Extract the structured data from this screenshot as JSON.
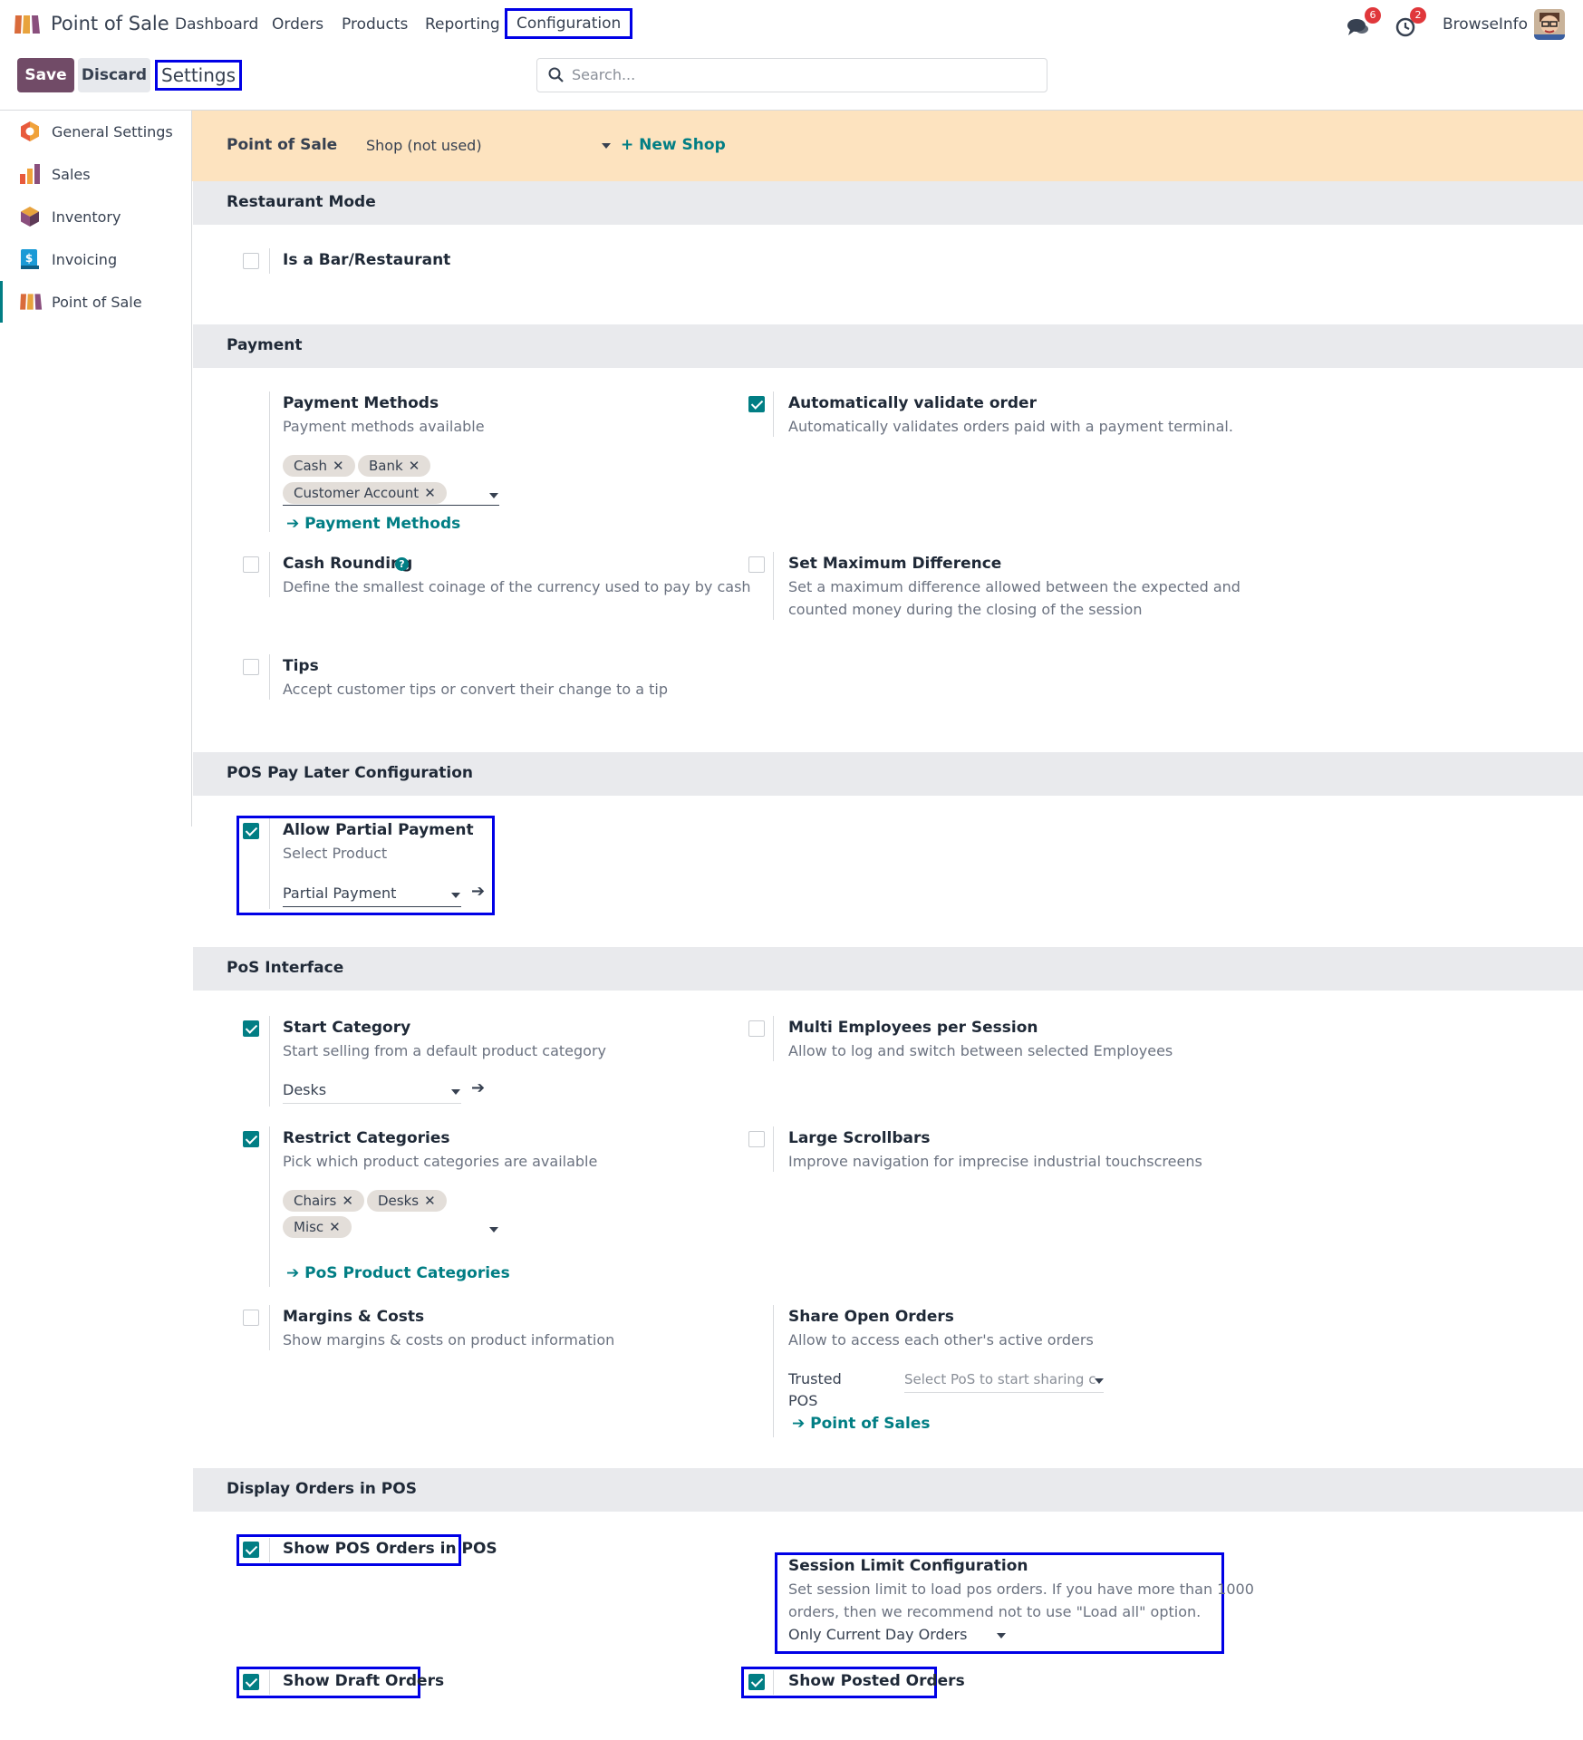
{
  "app": {
    "title": "Point of Sale"
  },
  "menu": {
    "items": [
      "Dashboard",
      "Orders",
      "Products",
      "Reporting",
      "Configuration"
    ]
  },
  "notifications": {
    "messages_count": "6",
    "activities_count": "2"
  },
  "user": {
    "name": "BrowseInfo"
  },
  "control": {
    "save_label": "Save",
    "discard_label": "Discard",
    "breadcrumb": "Settings",
    "search_placeholder": "Search..."
  },
  "sidebar": {
    "items": [
      {
        "label": "General Settings",
        "icon": "gear-hex-icon"
      },
      {
        "label": "Sales",
        "icon": "sales-chart-icon"
      },
      {
        "label": "Inventory",
        "icon": "inventory-box-icon"
      },
      {
        "label": "Invoicing",
        "icon": "invoice-dollar-icon"
      },
      {
        "label": "Point of Sale",
        "icon": "pos-shop-icon"
      }
    ]
  },
  "banner": {
    "label": "Point of Sale",
    "value": "Shop (not used)",
    "new_label": "+ New Shop"
  },
  "sections": {
    "restaurant": {
      "title": "Restaurant Mode",
      "is_bar": {
        "label": "Is a Bar/Restaurant",
        "checked": false
      }
    },
    "payment": {
      "title": "Payment",
      "methods": {
        "title": "Payment Methods",
        "desc": "Payment methods available",
        "tags": [
          "Cash",
          "Bank",
          "Customer Account"
        ],
        "link": "Payment Methods"
      },
      "auto_validate": {
        "title": "Automatically validate order",
        "desc": "Automatically validates orders paid with a payment terminal.",
        "checked": true
      },
      "cash_rounding": {
        "title": "Cash Rounding",
        "desc": "Define the smallest coinage of the currency used to pay by cash",
        "checked": false
      },
      "max_diff": {
        "title": "Set Maximum Difference",
        "desc1": "Set a maximum difference allowed between the expected and",
        "desc2": "counted money during the closing of the session",
        "checked": false
      },
      "tips": {
        "title": "Tips",
        "desc": "Accept customer tips or convert their change to a tip",
        "checked": false
      }
    },
    "paylater": {
      "title": "POS Pay Later Configuration",
      "partial": {
        "title": "Allow Partial Payment",
        "desc": "Select Product",
        "value": "Partial Payment",
        "checked": true
      }
    },
    "interface": {
      "title": "PoS Interface",
      "start_category": {
        "title": "Start Category",
        "desc": "Start selling from a default product category",
        "value": "Desks",
        "checked": true
      },
      "multi_employees": {
        "title": "Multi Employees per Session",
        "desc": "Allow to log and switch between selected Employees",
        "checked": false
      },
      "restrict": {
        "title": "Restrict Categories",
        "desc": "Pick which product categories are available",
        "tags": [
          "Chairs",
          "Desks",
          "Misc"
        ],
        "link": "PoS Product Categories",
        "checked": true
      },
      "large_scroll": {
        "title": "Large Scrollbars",
        "desc": "Improve navigation for imprecise industrial touchscreens",
        "checked": false
      },
      "margins": {
        "title": "Margins & Costs",
        "desc": "Show margins & costs on product information",
        "checked": false
      },
      "share_orders": {
        "title": "Share Open Orders",
        "desc": "Allow to access each other's active orders",
        "trusted_label1": "Trusted",
        "trusted_label2": "POS",
        "trusted_placeholder": "Select PoS to start sharing c",
        "link": "Point of Sales"
      }
    },
    "display": {
      "title": "Display Orders in POS",
      "show_pos": {
        "label": "Show POS Orders in POS",
        "checked": true
      },
      "session_limit": {
        "title": "Session Limit Configuration",
        "desc1": "Set session limit to load pos orders. If you have more than 1000",
        "desc2": "orders, then we recommend not to use \"Load all\" option.",
        "value": "Only Current Day Orders"
      },
      "show_draft": {
        "label": "Show Draft Orders",
        "checked": true
      },
      "show_posted": {
        "label": "Show Posted Orders",
        "checked": true
      }
    }
  },
  "colors": {
    "brand": "#714b67",
    "accent": "#017e84",
    "highlight": "#0000e6",
    "banner": "#fde3bf"
  }
}
